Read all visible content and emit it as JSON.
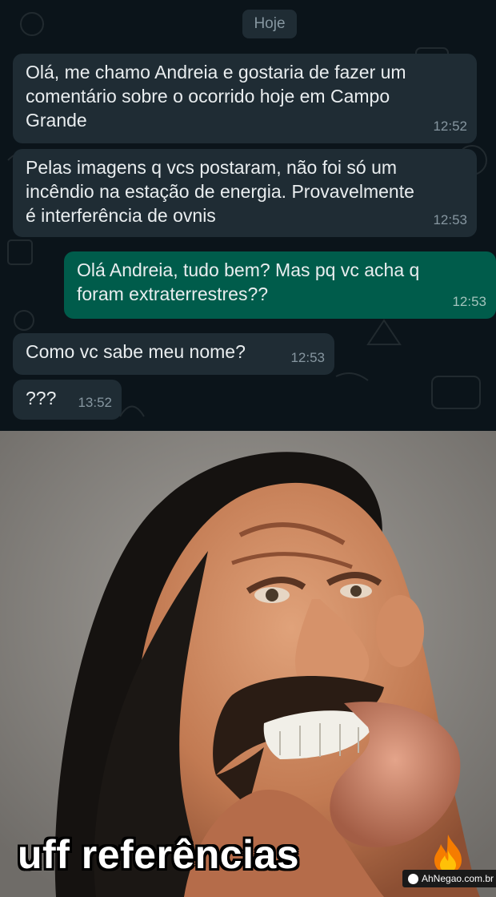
{
  "chat": {
    "date_chip": "Hoje",
    "messages": [
      {
        "direction": "in",
        "text": "Olá, me chamo Andreia e gostaria de fazer um\ncomentário sobre o ocorrido hoje em Campo\nGrande",
        "time": "12:52"
      },
      {
        "direction": "in",
        "text": "Pelas imagens q vcs postaram, não foi só um\nincêndio na estação de energia. Provavelmente\né interferência de ovnis",
        "time": "12:53"
      },
      {
        "direction": "out",
        "text": "Olá Andreia, tudo bem? Mas pq vc acha q\nforam extraterrestres??",
        "time": "12:53"
      },
      {
        "direction": "in",
        "text": "Como vc sabe meu nome?",
        "time": "12:53"
      },
      {
        "direction": "in",
        "text": "???",
        "time": "13:52"
      }
    ]
  },
  "meme": {
    "caption": "uff referências",
    "caption_emoji": "fire-icon",
    "watermark": "AhNegao.com.br"
  },
  "colors": {
    "chat_background": "#0b141a",
    "incoming_bubble": "#1f2c34",
    "outgoing_bubble": "#005c4b",
    "timestamp": "#8696a0"
  }
}
